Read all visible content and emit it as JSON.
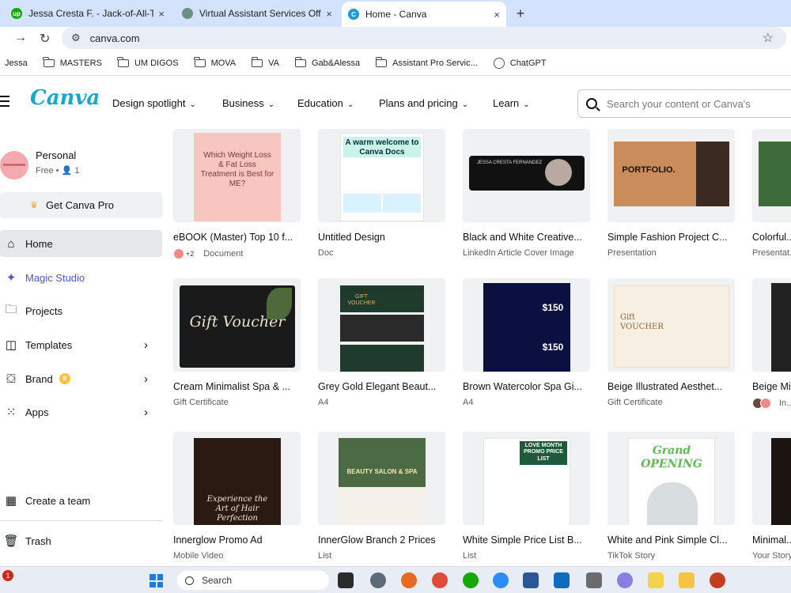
{
  "browser": {
    "tabs": [
      {
        "title": "Jessa Cresta F. - Jack-of-All-Trad",
        "favicon": "upwork-icon",
        "color": "#14a800"
      },
      {
        "title": "Virtual Assistant Services Offere",
        "favicon": "chatgpt-icon",
        "color": "#6c8f84"
      },
      {
        "title": "Home - Canva",
        "favicon": "canva-icon",
        "color": "#1b9bd1"
      }
    ],
    "new_tab": "+",
    "close_glyph": "×",
    "url": "canva.com",
    "bookmarks": [
      {
        "label": "Jessa",
        "type": "text"
      },
      {
        "label": "MASTERS",
        "type": "folder"
      },
      {
        "label": "UM DIGOS",
        "type": "folder"
      },
      {
        "label": "MOVA",
        "type": "folder"
      },
      {
        "label": "VA",
        "type": "folder"
      },
      {
        "label": "Gab&Alessa",
        "type": "folder"
      },
      {
        "label": "Assistant Pro Servic...",
        "type": "folder"
      },
      {
        "label": "ChatGPT",
        "type": "chatgpt"
      }
    ]
  },
  "canva": {
    "logo": "Canva",
    "nav": [
      "Design spotlight",
      "Business",
      "Education",
      "Plans and pricing",
      "Learn"
    ],
    "search_placeholder": "Search your content or Canva's",
    "account": {
      "name": "Personal",
      "plan": "Free",
      "members": "1"
    },
    "get_pro": "Get Canva Pro",
    "sidebar": [
      {
        "label": "Home",
        "icon": "home-icon",
        "active": true
      },
      {
        "label": "Magic Studio",
        "icon": "sparkle-icon"
      },
      {
        "label": "Projects",
        "icon": "folder-icon"
      },
      {
        "label": "Templates",
        "icon": "templates-icon",
        "arrow": true
      },
      {
        "label": "Brand",
        "icon": "brand-icon",
        "arrow": true,
        "crown": true
      },
      {
        "label": "Apps",
        "icon": "apps-icon",
        "arrow": true
      }
    ],
    "sidebar_bottom": [
      {
        "label": "Create a team",
        "icon": "team-icon"
      },
      {
        "label": "Trash",
        "icon": "trash-icon"
      }
    ],
    "designs": [
      {
        "name": "eBOOK (Master) Top 10 f...",
        "type": "Document",
        "collab": "+2",
        "thumb_bg": "#f7c6c0",
        "thumb_text": "Which Weight Loss & Fat Loss Treatment is Best for ME?"
      },
      {
        "name": "Untitled Design",
        "type": "Doc",
        "thumb_bg": "#ffffff",
        "thumb_text": "A warm welcome to Canva Docs"
      },
      {
        "name": "Black and White Creative...",
        "type": "LinkedIn Article Cover Image",
        "thumb_bg": "#111111",
        "thumb_text": "JESSA CRESTA FERNANDEZ"
      },
      {
        "name": "Simple Fashion Project C...",
        "type": "Presentation",
        "thumb_bg": "#c98c5a",
        "thumb_text": "PORTFOLIO."
      },
      {
        "name": "Colorful...",
        "type": "Presentat...",
        "thumb_bg": "#3e6b3a",
        "thumb_text": ""
      },
      {
        "name": "Cream Minimalist Spa & ...",
        "type": "Gift Certificate",
        "thumb_bg": "#1a1a1a",
        "thumb_text": "Gift Voucher"
      },
      {
        "name": "Grey Gold Elegant Beaut...",
        "type": "A4",
        "thumb_bg": "#1f3b2d",
        "thumb_text": "GIFT VOUCHER"
      },
      {
        "name": "Brown Watercolor Spa Gi...",
        "type": "A4",
        "thumb_bg": "#0c1040",
        "thumb_text": "$150"
      },
      {
        "name": "Beige Illustrated Aesthet...",
        "type": "Gift Certificate",
        "thumb_bg": "#f6efe2",
        "thumb_text": "Gift VOUCHER"
      },
      {
        "name": "Beige Mi...",
        "type": "In...",
        "thumb_bg": "#222222",
        "thumb_text": ""
      },
      {
        "name": "Innerglow Promo Ad",
        "type": "Mobile Video",
        "thumb_bg": "#2a1a12",
        "thumb_text": "Experience the Art of Hair Perfection"
      },
      {
        "name": "InnerGlow Branch 2 Prices",
        "type": "List",
        "thumb_bg": "#4c6b45",
        "thumb_text": "BEAUTY SALON & SPA"
      },
      {
        "name": "White Simple Price List B...",
        "type": "List",
        "thumb_bg": "#ffffff",
        "thumb_text": "LOVE MONTH PROMO PRICE LIST"
      },
      {
        "name": "White and Pink Simple Cl...",
        "type": "TikTok Story",
        "thumb_bg": "#ffffff",
        "thumb_text": "Grand OPENING"
      },
      {
        "name": "Minimal...",
        "type": "Your Story",
        "thumb_bg": "#1c1410",
        "thumb_text": ""
      }
    ]
  },
  "taskbar": {
    "search": "Search",
    "notification": "1"
  }
}
